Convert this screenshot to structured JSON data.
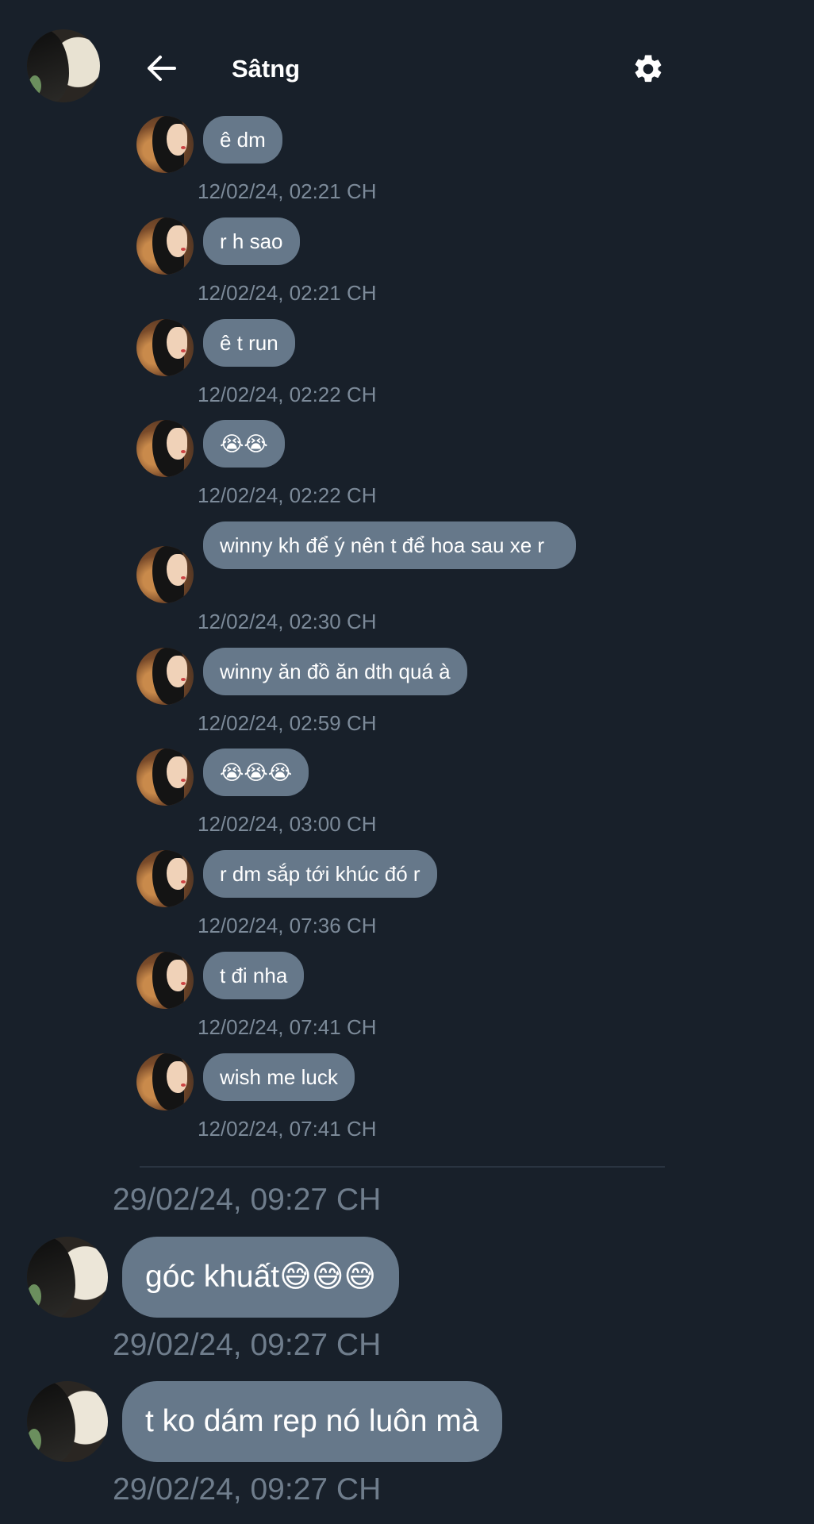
{
  "header": {
    "title": "Sâtng",
    "back_icon": "arrow-left-icon",
    "settings_icon": "gear-icon"
  },
  "messages": [
    {
      "text": "ê dm",
      "time": "12/02/24, 02:21 CH"
    },
    {
      "text": "r h sao",
      "time": "12/02/24, 02:21 CH"
    },
    {
      "text": "ê t run",
      "time": "12/02/24, 02:22 CH"
    },
    {
      "text": "😭😭",
      "time": "12/02/24, 02:22 CH"
    },
    {
      "text": "winny kh để ý nên t để hoa sau xe r",
      "time": "12/02/24, 02:30 CH"
    },
    {
      "text": "winny ăn đồ ăn dth quá à",
      "time": "12/02/24, 02:59 CH"
    },
    {
      "text": "😭😭😭",
      "time": "12/02/24, 03:00 CH"
    },
    {
      "text": "r dm sắp tới khúc đó r",
      "time": "12/02/24, 07:36 CH"
    },
    {
      "text": "t đi nha",
      "time": "12/02/24, 07:41 CH"
    },
    {
      "text": "wish me luck",
      "time": "12/02/24, 07:41 CH"
    }
  ],
  "recent": {
    "header_time": "29/02/24, 09:27 CH",
    "items": [
      {
        "text": "góc khuất😅😅😅",
        "time": "29/02/24, 09:27 CH"
      },
      {
        "text": "t ko dám rep nó luôn mà",
        "time": "29/02/24, 09:27 CH"
      }
    ]
  },
  "colors": {
    "background": "#18202a",
    "bubble": "#66788a",
    "timestamp": "#7c8a99"
  }
}
